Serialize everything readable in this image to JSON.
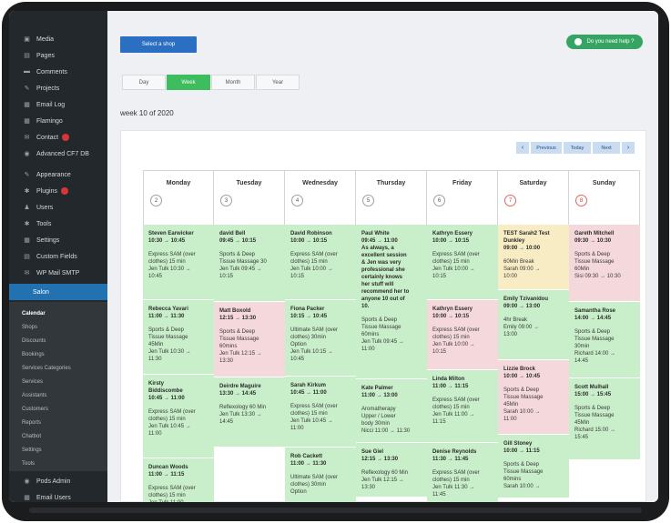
{
  "sidebar": {
    "items": [
      {
        "label": "Media",
        "icon": "media-icon",
        "glyph": "▣"
      },
      {
        "label": "Pages",
        "icon": "pages-icon",
        "glyph": "▤"
      },
      {
        "label": "Comments",
        "icon": "comments-icon",
        "glyph": "▬"
      },
      {
        "label": "Projects",
        "icon": "projects-icon",
        "glyph": "✎"
      },
      {
        "label": "Email Log",
        "icon": "email-log-icon",
        "glyph": "▦"
      },
      {
        "label": "Flamingo",
        "icon": "flamingo-icon",
        "glyph": "▦"
      },
      {
        "label": "Contact",
        "icon": "contact-icon",
        "glyph": "✉",
        "badge": true
      },
      {
        "label": "Advanced CF7 DB",
        "icon": "database-icon",
        "glyph": "◉"
      },
      {
        "label": "Appearance",
        "icon": "appearance-icon",
        "glyph": "✎"
      },
      {
        "label": "Plugins",
        "icon": "plugins-icon",
        "glyph": "✱",
        "badge": true
      },
      {
        "label": "Users",
        "icon": "users-icon",
        "glyph": "♟"
      },
      {
        "label": "Tools",
        "icon": "tools-icon",
        "glyph": "✱"
      },
      {
        "label": "Settings",
        "icon": "settings-icon",
        "glyph": "▦"
      },
      {
        "label": "Custom Fields",
        "icon": "custom-fields-icon",
        "glyph": "▤"
      },
      {
        "label": "WP Mail SMTP",
        "icon": "mail-smtp-icon",
        "glyph": "✉"
      },
      {
        "label": "Salon",
        "icon": "salon-icon",
        "glyph": "",
        "active": true
      }
    ],
    "submenu": [
      "Calendar",
      "Shops",
      "Discounts",
      "Bookings",
      "Services Categories",
      "Services",
      "Assistants",
      "Customers",
      "Reports",
      "Chatbot",
      "Settings",
      "Tools"
    ],
    "bottom_items": [
      {
        "label": "Pods Admin",
        "icon": "pods-icon",
        "glyph": "◉"
      },
      {
        "label": "Email Users",
        "icon": "email-users-icon",
        "glyph": "▦"
      }
    ]
  },
  "header": {
    "select_shop": "Select a shop",
    "help": "Do you need help ?"
  },
  "views": [
    "Day",
    "Week",
    "Month",
    "Year"
  ],
  "active_view": "Week",
  "week_title": "week 10 of 2020",
  "pager": {
    "previous": "Previous",
    "today": "Today",
    "next": "Next",
    "prev_arrow": "‹",
    "next_arrow": "›"
  },
  "days": [
    {
      "name": "Monday",
      "num": "2"
    },
    {
      "name": "Tuesday",
      "num": "3"
    },
    {
      "name": "Wednesday",
      "num": "4"
    },
    {
      "name": "Thursday",
      "num": "5"
    },
    {
      "name": "Friday",
      "num": "6"
    },
    {
      "name": "Saturday",
      "num": "7",
      "weekend": true
    },
    {
      "name": "Sunday",
      "num": "8",
      "weekend": true
    }
  ],
  "appointments": [
    {
      "day": 0,
      "color": "green",
      "title": "Steven Earwicker\n10:30 → 10:45",
      "desc": "Express SAM (over\nclothes) 15 min\nJen Tulk 10:30 →\n10:45"
    },
    {
      "day": 0,
      "color": "green",
      "title": "Rebecca Yavari\n11:00 → 11:30",
      "desc": "Sports & Deep\nTissue Massage\n45Min\nJen Tulk 10:30 →\n11:30"
    },
    {
      "day": 0,
      "color": "green",
      "title": "Kirsty\nBiddiscombe\n10:45 → 11:00",
      "desc": "Express SAM (over\nclothes) 15 min\nJen Tulk 10:45 →\n11:00"
    },
    {
      "day": 0,
      "color": "green",
      "title": "Duncan Woods\n11:00 → 11:15",
      "desc": "Express SAM (over\nclothes) 15 min\nJen Tulk 11:00 →"
    },
    {
      "day": 1,
      "color": "green",
      "title": "david Bell\n09:45 → 10:15",
      "desc": "Sports & Deep\nTissue Massage 30\nJen Tulk 09:45 →\n10:15"
    },
    {
      "day": 1,
      "color": "pink",
      "title": "Matt Boxold\n12:15 → 13:30",
      "desc": "Sports & Deep\nTissue Massage\n60mins\nJen Tulk 12:15 →\n13:30"
    },
    {
      "day": 1,
      "color": "green",
      "title": "Deirdre Maguire\n13:30 → 14:45",
      "desc": "Reflexology 60 Min\nJen Tulk 13:30 →\n14:45"
    },
    {
      "day": 2,
      "color": "green",
      "title": "David Robinson\n10:00 → 10:15",
      "desc": "Express SAM (over\nclothes) 15 min\nJen Tulk 10:00 →\n10:15"
    },
    {
      "day": 2,
      "color": "green",
      "title": "Fiona Packer\n10:15 → 10:45",
      "desc": "Ultimate SAM (over\nclothes) 30min\nOption\nJen Tulk 10:15 →\n10:45"
    },
    {
      "day": 2,
      "color": "green",
      "title": "Sarah Kirkum\n10:45 → 11:00",
      "desc": "Express SAM (over\nclothes) 15 min\nJen Tulk 10:45 →\n11:00"
    },
    {
      "day": 2,
      "color": "green",
      "title": "Rob Cackett\n11:00 → 11:30",
      "desc": "Ultimate SAM (over\nclothes) 30min\nOption"
    },
    {
      "day": 3,
      "color": "green",
      "title": "Paul White\n09:45 → 11:00\nAs always, a\nexcellent session\n& Jen was very\nprofessional she\ncertainly knows\nher stuff will\nrecommend her to\nanyone 10 out of\n10.",
      "desc": "Sports & Deep\nTissue Massage\n60mins\nJen Tulk 09:45 →\n11:00"
    },
    {
      "day": 3,
      "color": "green",
      "title": "Kate Palmer\n11:00 → 13:00",
      "desc": "Aromatherapy\nUpper / Lower\nbody 30min\nNicci 11:00 → 11:30"
    },
    {
      "day": 3,
      "color": "green",
      "title": "Sue Giel\n12:15 → 13:30",
      "desc": "Reflexology 60 Min\nJen Tulk 12:15 →\n13:30"
    },
    {
      "day": 4,
      "color": "green",
      "title": "Kathryn Essery\n10:00 → 10:15",
      "desc": "Express SAM (over\nclothes) 15 min\nJen Tulk 10:00 →\n10:15"
    },
    {
      "day": 4,
      "color": "pink",
      "title": "Kathryn Essery\n10:00 → 10:15",
      "desc": "Express SAM (over\nclothes) 15 min\nJen Tulk 10:00 →\n10:15"
    },
    {
      "day": 4,
      "color": "green",
      "title": "Linda Milton\n11:00 → 11:15",
      "desc": "Express SAM (over\nclothes) 15 min\nJen Tulk 11:00 →\n11:15"
    },
    {
      "day": 4,
      "color": "green",
      "title": "Denise Reynolds\n11:30 → 11:45",
      "desc": "Express SAM (over\nclothes) 15 min\nJen Tulk 11:30 →\n11:45"
    },
    {
      "day": 5,
      "color": "yellow",
      "title": "TEST Sarah2 Test\nDunkley\n09:00 → 10:00",
      "desc": "60Min Break\nSarah 09:00 →\n10:00"
    },
    {
      "day": 5,
      "color": "green",
      "title": "Emily Tzivanidou\n09:00 → 13:00",
      "desc": "4hr Break\nEmily 09:00 →\n13:00"
    },
    {
      "day": 5,
      "color": "pink",
      "title": "Lizzie Brock\n10:00 → 10:45",
      "desc": "Sports & Deep\nTissue Massage\n45Min\nSarah 10:00 →\n11:00"
    },
    {
      "day": 5,
      "color": "green",
      "title": "Gill Stoney\n10:00 → 11:15",
      "desc": "Sports & Deep\nTissue Massage\n60mins\nSarah 10:00 →"
    },
    {
      "day": 6,
      "color": "pink",
      "title": "Gareth Mitchell\n09:30 → 10:30",
      "desc": "Sports & Deep\nTissue Massage\n60Min\nSisi 09:30 → 10:30"
    },
    {
      "day": 6,
      "color": "green",
      "title": "Samantha Rose\n14:00 → 14:45",
      "desc": "Sports & Deep\nTissue Massage\n30min\nRichard 14:00 →\n14:45"
    },
    {
      "day": 6,
      "color": "green",
      "title": "Scott Mulhall\n15:00 → 15:45",
      "desc": "Sports & Deep\nTissue Massage\n45Min\nRichard 15:00 →\n15:45"
    }
  ],
  "colors": {
    "green": "#c8efc9",
    "pink": "#f5d8dc",
    "yellow": "#f7ecc4",
    "accent_blue": "#2a6fc2",
    "accent_green": "#3dbd5d",
    "sidebar": "#23282d"
  }
}
